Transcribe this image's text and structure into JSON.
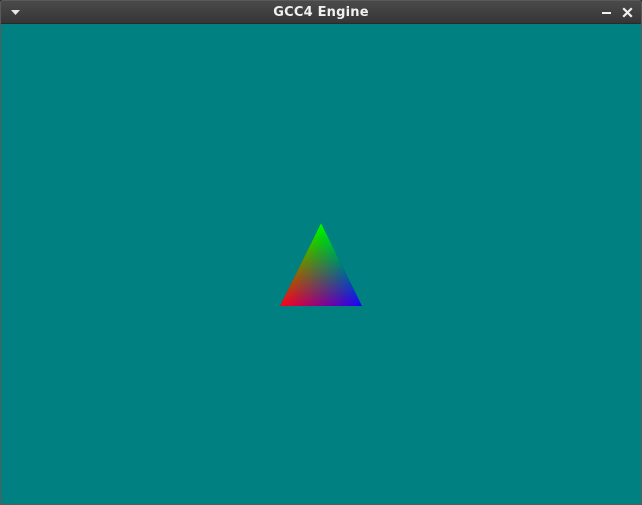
{
  "window": {
    "title": "GCC4 Engine",
    "clear_color": "#008080"
  },
  "titlebar": {
    "menu_icon": "chevron-down-icon",
    "minimize_icon": "minimize-icon",
    "close_icon": "close-icon"
  },
  "scene": {
    "shape": "triangle",
    "vertex_colors": {
      "top": "#00ff00",
      "bottom_left": "#ff0000",
      "bottom_right": "#0000ff"
    }
  }
}
